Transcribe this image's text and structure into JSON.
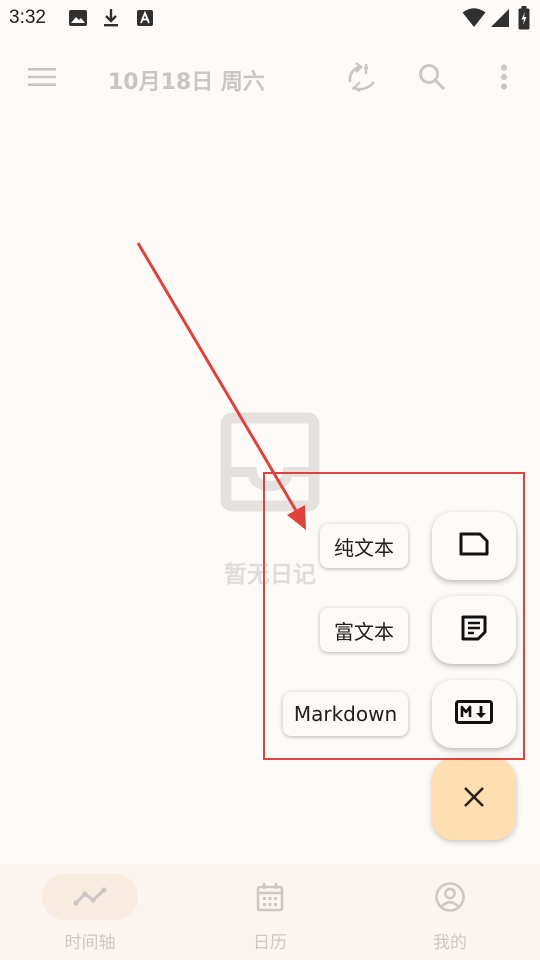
{
  "status_bar": {
    "time": "3:32",
    "icons": [
      "image-icon",
      "download-icon",
      "a-box-icon",
      "wifi-icon",
      "signal-icon",
      "battery-charging-icon"
    ]
  },
  "app_bar": {
    "title": "10月18日 周六",
    "menu_icon": "menu-icon",
    "sync_icon": "sync-icon",
    "search_icon": "search-icon",
    "more_icon": "more-vert-icon"
  },
  "empty_state": {
    "icon": "inbox-icon",
    "text": "暂无日记"
  },
  "speed_dial": {
    "items": [
      {
        "label": "纯文本",
        "icon": "note-icon"
      },
      {
        "label": "富文本",
        "icon": "rich-note-icon"
      },
      {
        "label": "Markdown",
        "icon": "markdown-icon"
      }
    ],
    "close_icon": "close-icon"
  },
  "bottom_nav": {
    "items": [
      {
        "label": "时间轴",
        "icon": "timeline-icon",
        "active": true
      },
      {
        "label": "日历",
        "icon": "calendar-icon",
        "active": false
      },
      {
        "label": "我的",
        "icon": "account-icon",
        "active": false
      }
    ]
  },
  "colors": {
    "annotation": "#e0423c",
    "fab_main": "#ffdfb1",
    "background": "#fdfaf7"
  }
}
